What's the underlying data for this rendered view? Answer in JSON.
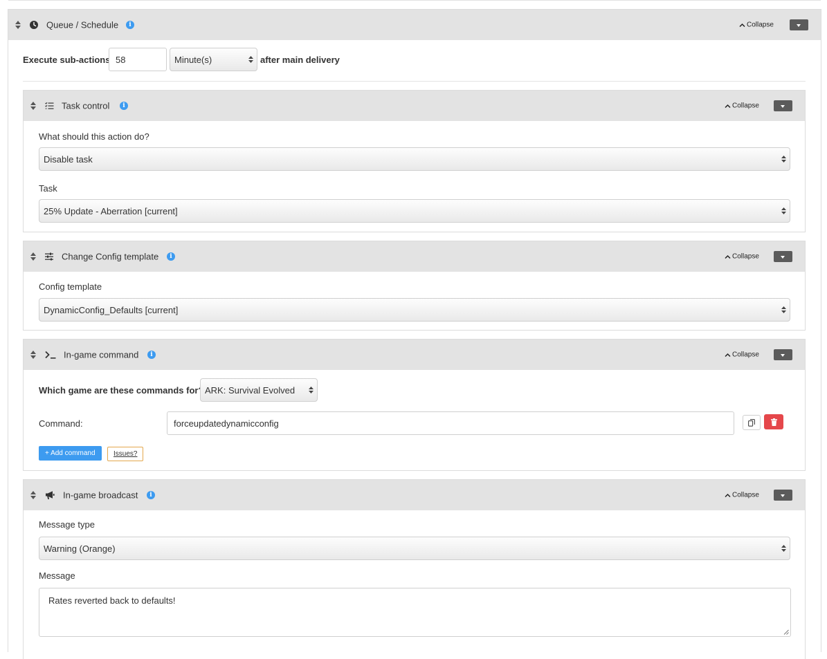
{
  "queue": {
    "title": "Queue / Schedule",
    "collapse_label": "Collapse",
    "execute_label": "Execute sub-actions",
    "delay_value": "58",
    "delay_unit": "Minute(s)",
    "after_label": "after main delivery"
  },
  "task_control": {
    "title": "Task control",
    "collapse_label": "Collapse",
    "action_label": "What should this action do?",
    "action_value": "Disable task",
    "task_label": "Task",
    "task_value": "25% Update - Aberration [current]"
  },
  "config_template": {
    "title": "Change Config template",
    "collapse_label": "Collapse",
    "template_label": "Config template",
    "template_value": "DynamicConfig_Defaults [current]"
  },
  "ingame_command": {
    "title": "In-game command",
    "collapse_label": "Collapse",
    "game_label": "Which game are these commands for?",
    "game_value": "ARK: Survival Evolved",
    "command_label": "Command:",
    "command_value": "forceupdatedynamicconfig",
    "add_command_label": "+ Add command",
    "issues_label": "Issues?"
  },
  "ingame_broadcast": {
    "title": "In-game broadcast",
    "collapse_label": "Collapse",
    "message_type_label": "Message type",
    "message_type_value": "Warning (Orange)",
    "message_label": "Message",
    "message_value": "Rates reverted back to defaults!"
  },
  "icons": {
    "info": "i",
    "clock": "clock-icon",
    "tasks": "tasks-icon",
    "sliders": "sliders-icon",
    "terminal": "terminal-icon",
    "megaphone": "megaphone-icon",
    "copy": "copy-icon",
    "trash": "trash-icon"
  },
  "colors": {
    "accent_blue": "#3d9bf0",
    "danger_red": "#e5474b",
    "warning_orange": "#e3a74c",
    "header_gray": "#e3e3e3"
  }
}
